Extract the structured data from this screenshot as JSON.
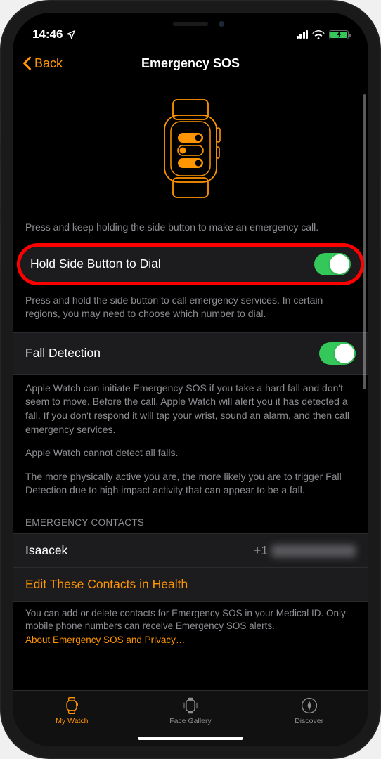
{
  "status": {
    "time": "14:46"
  },
  "nav": {
    "back": "Back",
    "title": "Emergency SOS"
  },
  "intro": {
    "description": "Press and keep holding the side button to make an emergency call."
  },
  "holdSide": {
    "label": "Hold Side Button to Dial",
    "footer": "Press and hold the side button to call emergency services. In certain regions, you may need to choose which number to dial."
  },
  "fallDetection": {
    "label": "Fall Detection",
    "desc1": "Apple Watch can initiate Emergency SOS if you take a hard fall and don't seem to move. Before the call, Apple Watch will alert you it has detected a fall. If you don't respond it will tap your wrist, sound an alarm, and then call emergency services.",
    "desc2": "Apple Watch cannot detect all falls.",
    "desc3": "The more physically active you are, the more likely you are to trigger Fall Detection due to high impact activity that can appear to be a fall."
  },
  "contacts": {
    "header": "EMERGENCY CONTACTS",
    "name": "Isaacek",
    "phonePrefix": "+1",
    "editLink": "Edit These Contacts in Health",
    "footer": "You can add or delete contacts for Emergency SOS in your Medical ID. Only mobile phone numbers can receive Emergency SOS alerts.",
    "about": "About Emergency SOS and Privacy…"
  },
  "tabs": {
    "watch": "My Watch",
    "gallery": "Face Gallery",
    "discover": "Discover"
  }
}
